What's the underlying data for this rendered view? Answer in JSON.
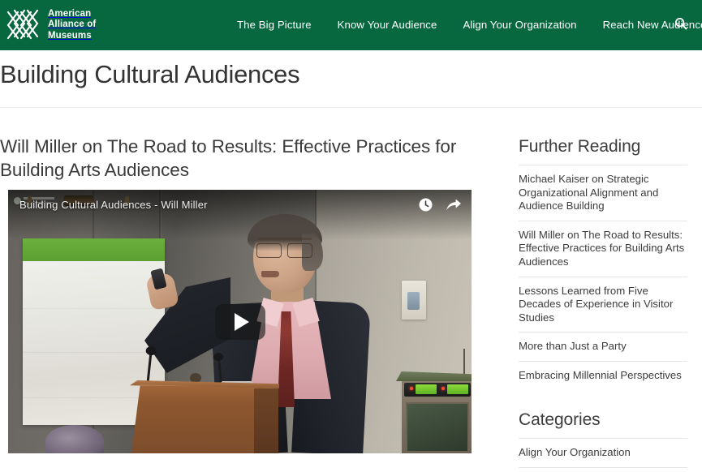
{
  "header": {
    "logo": {
      "icon": "lattice-diamond-logo",
      "line1": "American",
      "line2": "Alliance of",
      "line3": "Museums"
    },
    "nav_items": [
      {
        "label": "The Big Picture"
      },
      {
        "label": "Know Your Audience"
      },
      {
        "label": "Align Your Organization"
      },
      {
        "label": "Reach New Audiences"
      }
    ],
    "search_icon": "search-icon",
    "background_color": "#07683F",
    "text_color": "#FFFFFF"
  },
  "page": {
    "title": "Building Cultural Audiences"
  },
  "article": {
    "title": "Will Miller on The Road to Results: Effective Practices for Building Arts Audiences"
  },
  "video": {
    "title": "Building Cultural Audiences - Will Miller",
    "watch_later_icon": "clock-icon",
    "share_icon": "share-arrow-icon",
    "play_icon": "play-triangle-icon"
  },
  "sidebar": {
    "further_reading": {
      "heading": "Further Reading",
      "links": [
        {
          "label": "Michael Kaiser on Strategic Organizational Alignment and Audience Building"
        },
        {
          "label": "Will Miller on The Road to Results: Effective Practices for Building Arts Audiences"
        },
        {
          "label": "Lessons Learned from Five Decades of Experience in Visitor Studies"
        },
        {
          "label": "More than Just a Party"
        },
        {
          "label": "Embracing Millennial Perspectives"
        }
      ]
    },
    "categories": {
      "heading": "Categories",
      "links": [
        {
          "label": "Align Your Organization"
        }
      ]
    }
  }
}
